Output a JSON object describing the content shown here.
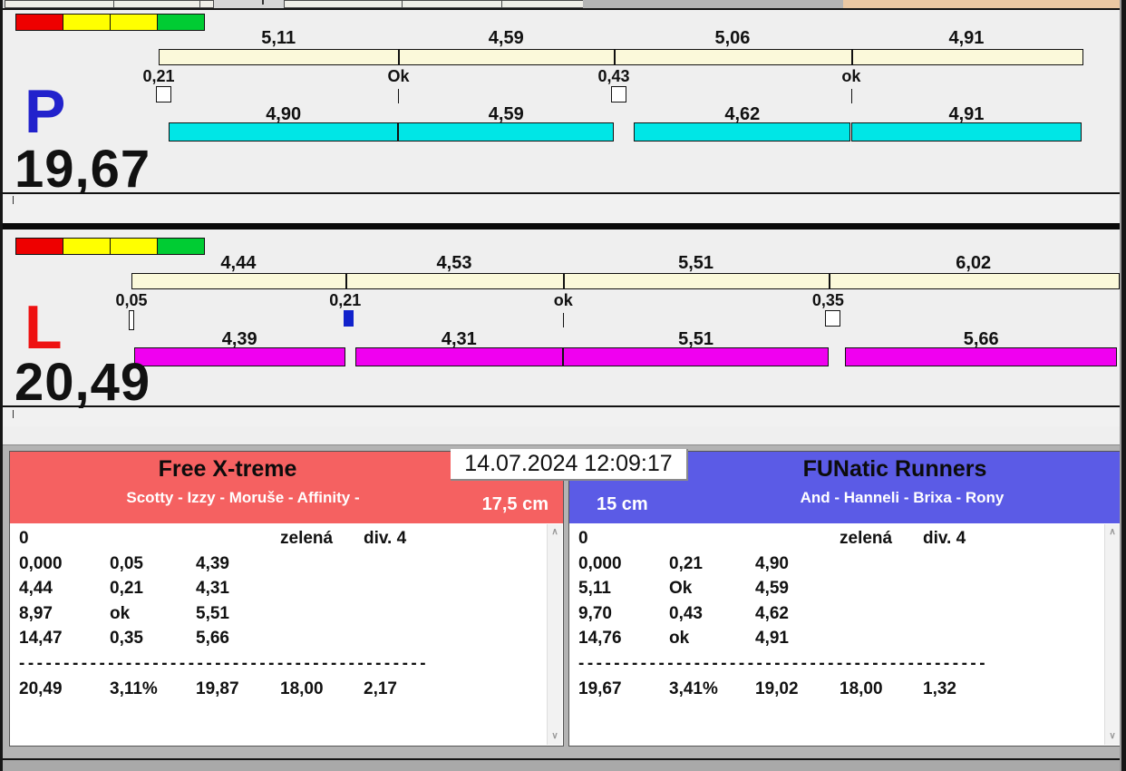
{
  "window": {
    "top_edge_beige_color": "#ebc9a4"
  },
  "lanes": [
    {
      "id": "p",
      "letter": "P",
      "letter_color": "#2222cc",
      "total_label": "19,67",
      "total_seconds": 19.67,
      "indicator_colors": [
        "#ee0000",
        "#ffff00",
        "#ffff00",
        "#00cc33"
      ],
      "split_bar": {
        "color": "#fbf9da",
        "segments": [
          {
            "label": "5,11",
            "seconds": 5.11
          },
          {
            "label": "4,59",
            "seconds": 4.59
          },
          {
            "label": "5,06",
            "seconds": 5.06
          },
          {
            "label": "4,91",
            "seconds": 4.91
          }
        ]
      },
      "exchange_markers": [
        {
          "label": "0,21",
          "time": 0,
          "type": "square-white"
        },
        {
          "label": "Ok",
          "time": 5.11,
          "type": "tick"
        },
        {
          "label": "0,43",
          "time": 9.7,
          "type": "square-white"
        },
        {
          "label": "ok",
          "time": 14.76,
          "type": "tick"
        }
      ],
      "dog_bar": {
        "color": "#00e6e6",
        "segments": [
          {
            "label": "4,90",
            "start": 0.21,
            "seconds": 4.9
          },
          {
            "label": "4,59",
            "start": 5.11,
            "seconds": 4.59
          },
          {
            "label": "4,62",
            "start": 10.13,
            "seconds": 4.62
          },
          {
            "label": "4,91",
            "start": 14.76,
            "seconds": 4.91
          }
        ]
      }
    },
    {
      "id": "l",
      "letter": "L",
      "letter_color": "#ee1111",
      "total_label": "20,49",
      "total_seconds": 20.49,
      "indicator_colors": [
        "#ee0000",
        "#ffff00",
        "#ffff00",
        "#00cc33"
      ],
      "split_bar": {
        "color": "#fbf9da",
        "segments": [
          {
            "label": "4,44",
            "seconds": 4.44
          },
          {
            "label": "4,53",
            "seconds": 4.53
          },
          {
            "label": "5,51",
            "seconds": 5.51
          },
          {
            "label": "6,02",
            "seconds": 6.02
          }
        ]
      },
      "exchange_markers": [
        {
          "label": "0,05",
          "time": 0,
          "type": "bar-thin"
        },
        {
          "label": "0,21",
          "time": 4.44,
          "type": "square-blue"
        },
        {
          "label": "ok",
          "time": 8.97,
          "type": "tick"
        },
        {
          "label": "0,35",
          "time": 14.47,
          "type": "square-white"
        }
      ],
      "dog_bar": {
        "color": "#f000f0",
        "segments": [
          {
            "label": "4,39",
            "start": 0.05,
            "seconds": 4.39
          },
          {
            "label": "4,31",
            "start": 4.65,
            "seconds": 4.31
          },
          {
            "label": "5,51",
            "start": 8.97,
            "seconds": 5.51
          },
          {
            "label": "5,66",
            "start": 14.82,
            "seconds": 5.66
          }
        ]
      }
    }
  ],
  "footer": {
    "datetime": "14.07.2024 12:09:17",
    "teams": [
      {
        "side": "left",
        "name": "Free X-treme",
        "members": "Scotty - Izzy - Moruše - Affinity -",
        "jump_height": "17,5 cm",
        "header_color": "#f56161",
        "rows": [
          [
            "0",
            "",
            "",
            "zelená",
            "div. 4"
          ],
          [
            "0,000",
            "0,05",
            "4,39",
            "",
            ""
          ],
          [
            "4,44",
            "0,21",
            "4,31",
            "",
            ""
          ],
          [
            "8,97",
            "ok",
            "5,51",
            "",
            ""
          ],
          [
            "14,47",
            "0,35",
            "5,66",
            "",
            ""
          ]
        ],
        "separator": "----------------------------------------------",
        "totals": [
          "20,49",
          "3,11%",
          "19,87",
          "18,00",
          "2,17"
        ]
      },
      {
        "side": "right",
        "name": "FUNatic Runners",
        "members": "And - Hanneli - Brixa - Rony",
        "jump_height": "15 cm",
        "header_color": "#5b5be6",
        "rows": [
          [
            "0",
            "",
            "",
            "zelená",
            "div. 4"
          ],
          [
            "0,000",
            "0,21",
            "4,90",
            "",
            ""
          ],
          [
            "5,11",
            "Ok",
            "4,59",
            "",
            ""
          ],
          [
            "9,70",
            "0,43",
            "4,62",
            "",
            ""
          ],
          [
            "14,76",
            "ok",
            "4,91",
            "",
            ""
          ]
        ],
        "separator": "----------------------------------------------",
        "totals": [
          "19,67",
          "3,41%",
          "19,02",
          "18,00",
          "1,32"
        ]
      }
    ],
    "scrollbar": {
      "up_glyph": "∧",
      "down_glyph": "∨"
    }
  }
}
